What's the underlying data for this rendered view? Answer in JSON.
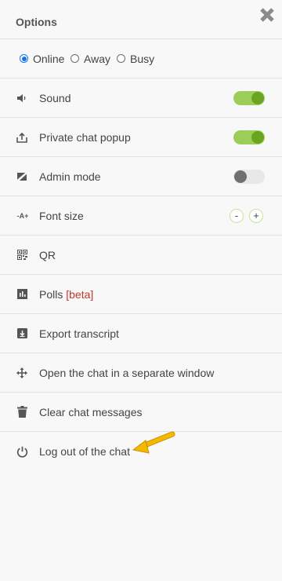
{
  "header": {
    "title": "Options",
    "close_icon": "close-x-icon"
  },
  "status": {
    "options": [
      {
        "label": "Online",
        "checked": true
      },
      {
        "label": "Away",
        "checked": false
      },
      {
        "label": "Busy",
        "checked": false
      }
    ]
  },
  "items": [
    {
      "label": "Sound",
      "icon": "speaker-icon",
      "toggle": true
    },
    {
      "label": "Private chat popup",
      "icon": "popup-icon",
      "toggle": true
    },
    {
      "label": "Admin mode",
      "icon": "admin-icon",
      "toggle": false
    },
    {
      "label": "Font size",
      "icon": "font-size-icon",
      "decrease": "-",
      "increase": "+"
    },
    {
      "label": "QR",
      "icon": "qr-icon"
    },
    {
      "label": "Polls",
      "badge": "[beta]",
      "icon": "poll-icon"
    },
    {
      "label": "Export transcript",
      "icon": "export-icon"
    },
    {
      "label": "Open the chat in a separate window",
      "icon": "move-icon"
    },
    {
      "label": "Clear chat messages",
      "icon": "trash-icon"
    },
    {
      "label": "Log out of the chat",
      "icon": "power-icon"
    }
  ],
  "font_size_icon_text": "-A+",
  "colors": {
    "toggle_on": "#9ccc5a",
    "radio_accent": "#1a73e8",
    "beta": "#c0392b",
    "arrow": "#f5b800"
  }
}
